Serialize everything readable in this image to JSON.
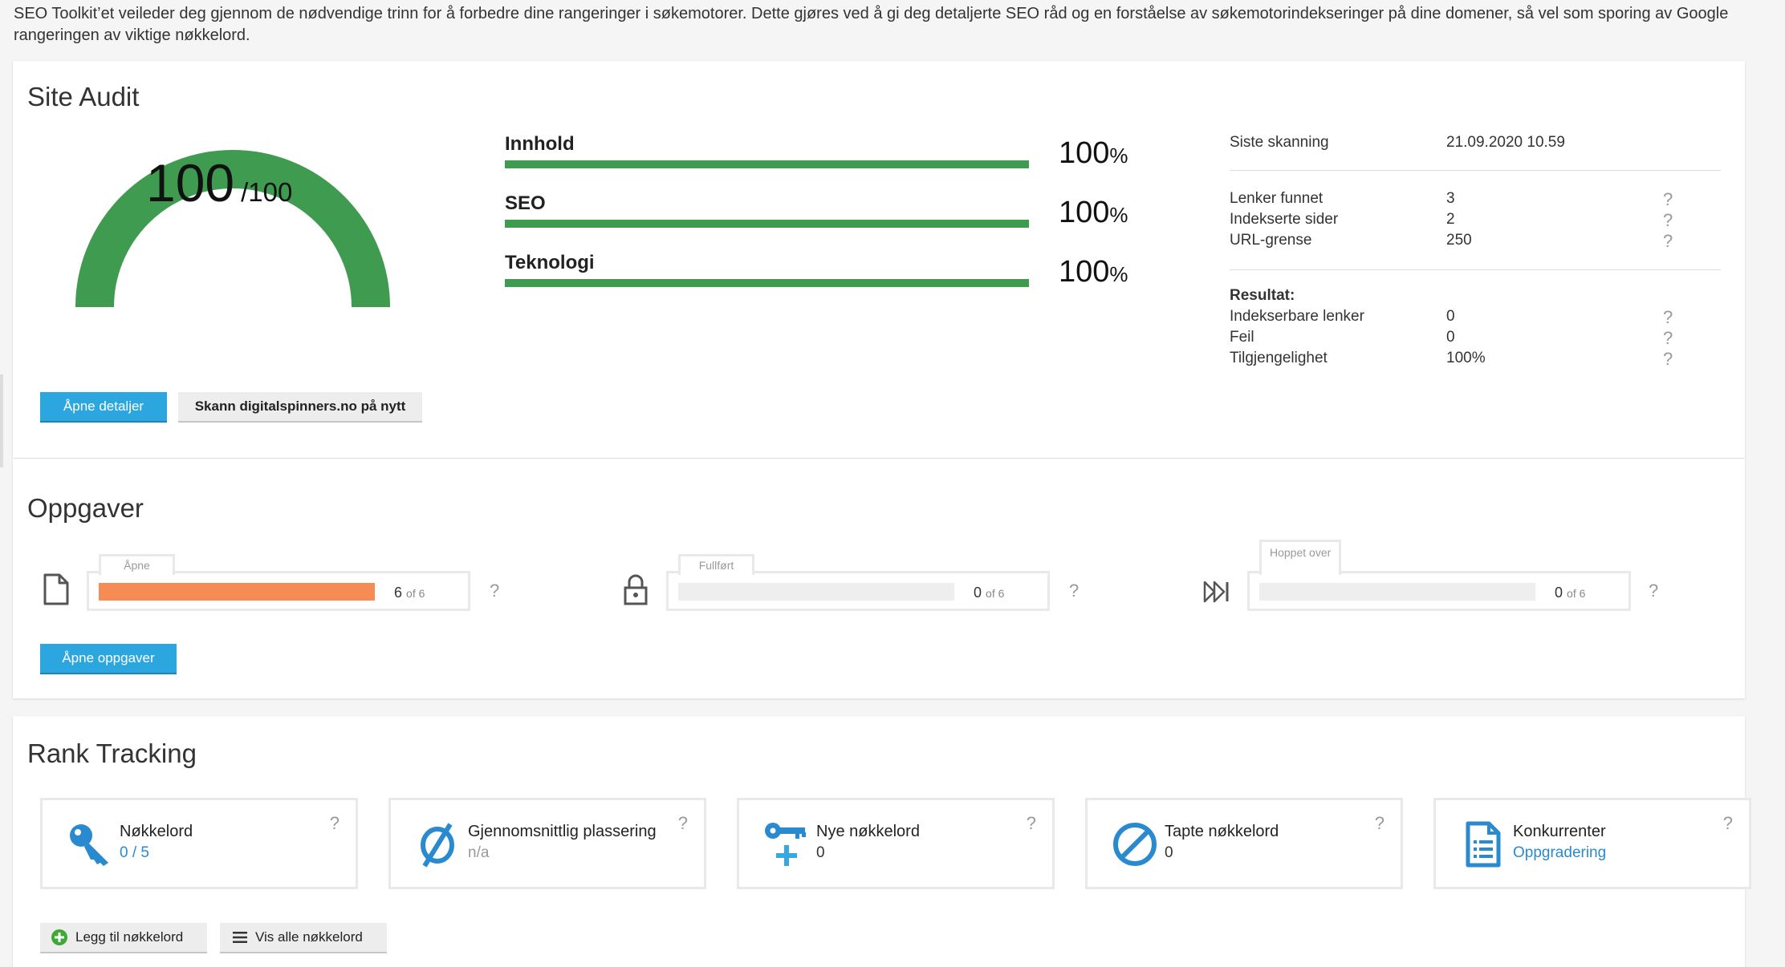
{
  "intro": "SEO Toolkit’et veileder deg gjennom de nødvendige trinn for å forbedre dine rangeringer i søkemotorer. Dette gjøres ved å gi deg detaljerte SEO råd og en forståelse av søkemotorindekseringer på dine domener, så vel som sporing av Google rangeringen av viktige nøkkelord.",
  "colors": {
    "accent": "#2ba6de",
    "success": "#3f9b4f",
    "warning": "#f78b55",
    "icon_blue": "#2a8ad0"
  },
  "audit": {
    "title": "Site Audit",
    "score": "100",
    "score_max": "/100",
    "score_value": 100,
    "categories": [
      {
        "label": "Innhold",
        "value": "100",
        "unit": "%",
        "fill": 100
      },
      {
        "label": "SEO",
        "value": "100",
        "unit": "%",
        "fill": 100
      },
      {
        "label": "Teknologi",
        "value": "100",
        "unit": "%",
        "fill": 100
      }
    ],
    "last_scan_label": "Siste skanning",
    "last_scan_value": "21.09.2020 10.59",
    "stats": [
      {
        "label": "Lenker funnet",
        "value": "3",
        "help": "?"
      },
      {
        "label": "Indekserte sider",
        "value": "2",
        "help": "?"
      },
      {
        "label": "URL-grense",
        "value": "250",
        "help": "?"
      }
    ],
    "result_heading": "Resultat:",
    "results": [
      {
        "label": "Indekserbare lenker",
        "value": "0",
        "help": "?"
      },
      {
        "label": "Feil",
        "value": "0",
        "help": "?"
      },
      {
        "label": "Tilgjengelighet",
        "value": "100%",
        "help": "?"
      }
    ],
    "open_details": "Åpne detaljer",
    "rescan": "Skann digitalspinners.no på nytt"
  },
  "tasks": {
    "title": "Oppgaver",
    "items": [
      {
        "label": "Åpne",
        "count": "6",
        "of": "of 6",
        "fill": 100,
        "icon": "document-icon",
        "help": "?"
      },
      {
        "label": "Fullført",
        "count": "0",
        "of": "of 6",
        "fill": 0,
        "icon": "lock-icon",
        "help": "?"
      },
      {
        "label": "Hoppet over",
        "count": "0",
        "of": "of 6",
        "fill": 0,
        "icon": "skip-forward-icon",
        "help": "?"
      }
    ],
    "open_tasks": "Åpne oppgaver"
  },
  "rank": {
    "title": "Rank Tracking",
    "boxes": [
      {
        "title": "Nøkkelord",
        "value": "0 / 5",
        "icon": "key-icon",
        "help": "?"
      },
      {
        "title": "Gjennomsnittlig plassering",
        "value": "n/a",
        "icon": "average-icon",
        "help": "?"
      },
      {
        "title": "Nye nøkkelord",
        "value": "0",
        "icon": "new-key-icon",
        "help": "?"
      },
      {
        "title": "Tapte nøkkelord",
        "value": "0",
        "icon": "prohibited-icon",
        "help": "?"
      },
      {
        "title": "Konkurrenter",
        "value": "Oppgradering",
        "icon": "document-list-icon",
        "help": "?"
      }
    ],
    "add_keyword": "Legg til nøkkelord",
    "show_all": "Vis alle nøkkelord"
  }
}
